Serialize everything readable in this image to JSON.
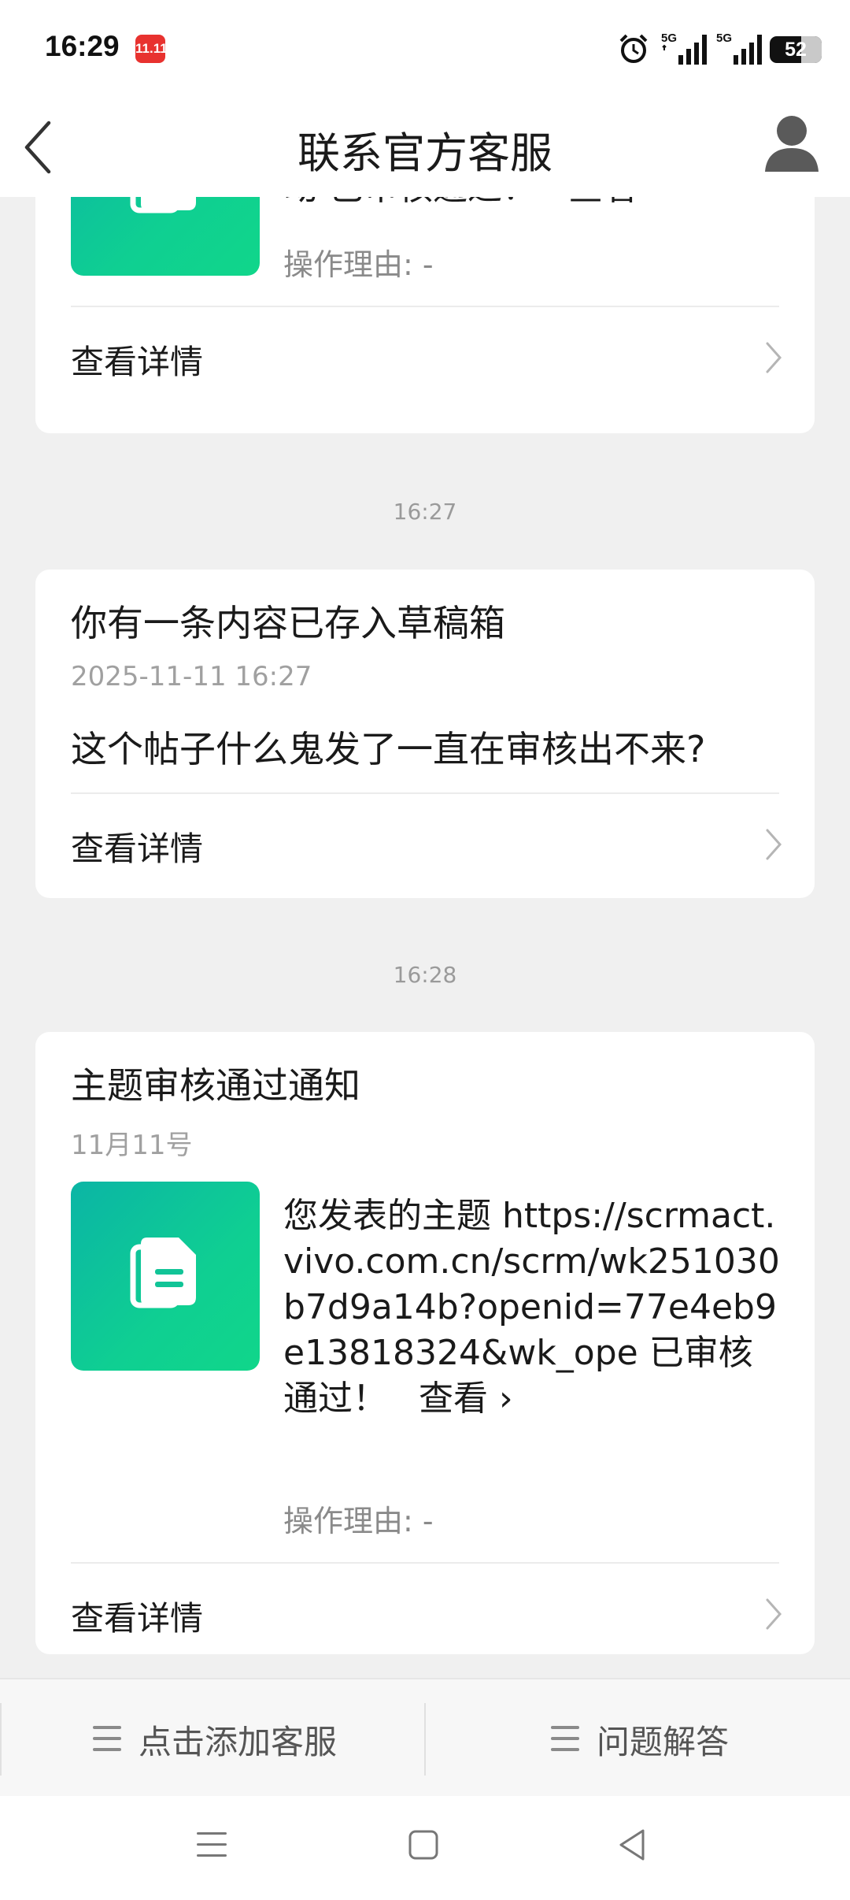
{
  "status_bar": {
    "time": "16:29",
    "badge": "11.11",
    "network_1": "5G",
    "network_2": "5G",
    "battery": "52"
  },
  "header": {
    "title": "联系官方客服"
  },
  "messages": {
    "card1": {
      "text_tail": "动 已审核通过！",
      "view_label": "查看 ›",
      "reason": "操作理由: -",
      "detail_label": "查看详情"
    },
    "time2": "16:27",
    "card2": {
      "title": "你有一条内容已存入草稿箱",
      "date": "2025-11-11 16:27",
      "body": "这个帖子什么鬼发了一直在审核出不来?",
      "detail_label": "查看详情"
    },
    "time3": "16:28",
    "card3": {
      "title": "主题审核通过通知",
      "date": "11月11号",
      "text": "您发表的主题 https://scrmact.vivo.com.cn/scrm/wk251030b7d9a14b?openid=77e4eb9e13818324&wk_ope 已审核通过！",
      "view_label": "查看 ›",
      "reason": "操作理由: -",
      "detail_label": "查看详情"
    }
  },
  "bottom_menu": {
    "add_service": "点击添加客服",
    "faq": "问题解答"
  },
  "colors": {
    "accent_gradient_start": "#0bb5a5",
    "accent_gradient_end": "#10d68a",
    "background": "#f0f0f0"
  }
}
